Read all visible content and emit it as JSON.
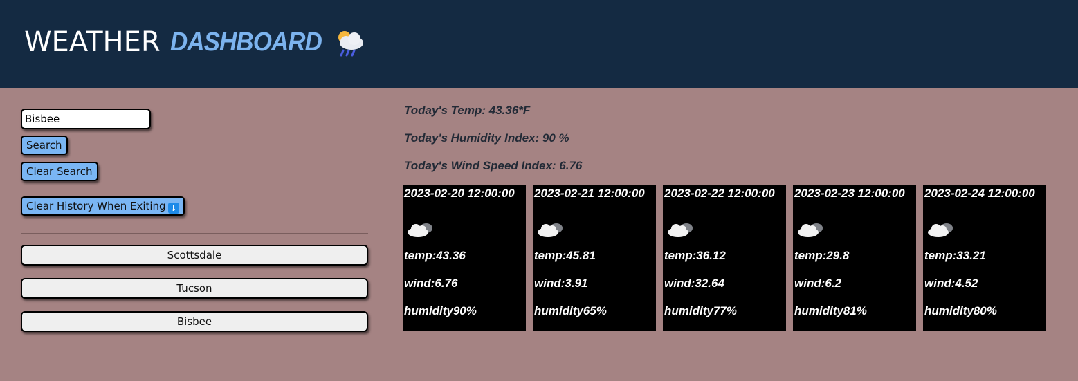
{
  "header": {
    "title_word": "WEATHER",
    "title_accent": "DASHBOARD",
    "icon": "cloud-rain-sun-icon"
  },
  "sidebar": {
    "search_value": "Bisbee",
    "search_button": "Search",
    "clear_search_button": "Clear Search",
    "clear_history_button": "Clear History When Exiting",
    "clear_history_icon": "down-arrow-icon",
    "history": [
      "Scottsdale",
      "Tucson",
      "Bisbee"
    ]
  },
  "today": {
    "temp": "Today's Temp: 43.36*F",
    "humidity": "Today's Humidity Index: 90 %",
    "wind": "Today's Wind Speed Index: 6.76"
  },
  "forecast": [
    {
      "date": "2023-02-20 12:00:00",
      "icon": "cloud-icon",
      "temp": "temp:43.36",
      "wind": "wind:6.76",
      "humidity": "humidity90%"
    },
    {
      "date": "2023-02-21 12:00:00",
      "icon": "cloud-icon",
      "temp": "temp:45.81",
      "wind": "wind:3.91",
      "humidity": "humidity65%"
    },
    {
      "date": "2023-02-22 12:00:00",
      "icon": "cloud-icon",
      "temp": "temp:36.12",
      "wind": "wind:32.64",
      "humidity": "humidity77%"
    },
    {
      "date": "2023-02-23 12:00:00",
      "icon": "cloud-icon",
      "temp": "temp:29.8",
      "wind": "wind:6.2",
      "humidity": "humidity81%"
    },
    {
      "date": "2023-02-24 12:00:00",
      "icon": "cloud-icon",
      "temp": "temp:33.21",
      "wind": "wind:4.52",
      "humidity": "humidity80%"
    }
  ],
  "colors": {
    "header_bg": "#142a42",
    "page_bg": "#a58383",
    "accent": "#7cb3ee",
    "button_bg": "#7ab6f4",
    "card_bg": "#000000"
  }
}
